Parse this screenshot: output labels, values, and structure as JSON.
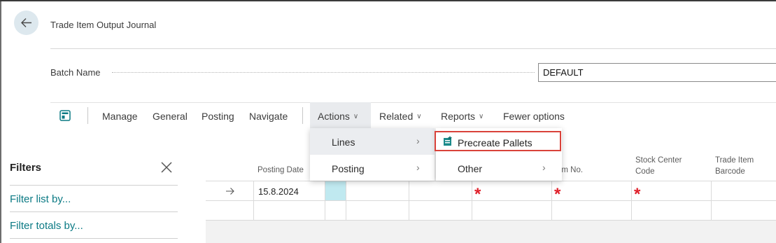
{
  "page": {
    "title": "Trade Item Output Journal",
    "back_icon": "arrow-left-icon"
  },
  "batch": {
    "label": "Batch Name",
    "value": "DEFAULT"
  },
  "action_bar": {
    "items": [
      "Manage",
      "General",
      "Posting",
      "Navigate"
    ],
    "actions_label": "Actions",
    "related_label": "Related",
    "reports_label": "Reports",
    "fewer_label": "Fewer options"
  },
  "actions_menu": {
    "lines_label": "Lines",
    "posting_label": "Posting"
  },
  "lines_submenu": {
    "precreate_label": "Precreate Pallets",
    "other_label": "Other"
  },
  "filters": {
    "title": "Filters",
    "filter_list": "Filter list by...",
    "filter_totals": "Filter totals by..."
  },
  "grid": {
    "headers": {
      "posting_date": "Posting Date",
      "item_no": "em No.",
      "stock_center_l1": "Stock Center",
      "stock_center_l2": "Code",
      "trade_item_l1": "Trade Item",
      "trade_item_l2": "Barcode"
    },
    "row1": {
      "posting_date": "15.8.2024",
      "required_mark": "*"
    }
  },
  "colors": {
    "accent_link": "#0b7a84",
    "highlight_border": "#d9423a",
    "required": "#e0202a",
    "selected_cell": "#c0e9f0"
  }
}
